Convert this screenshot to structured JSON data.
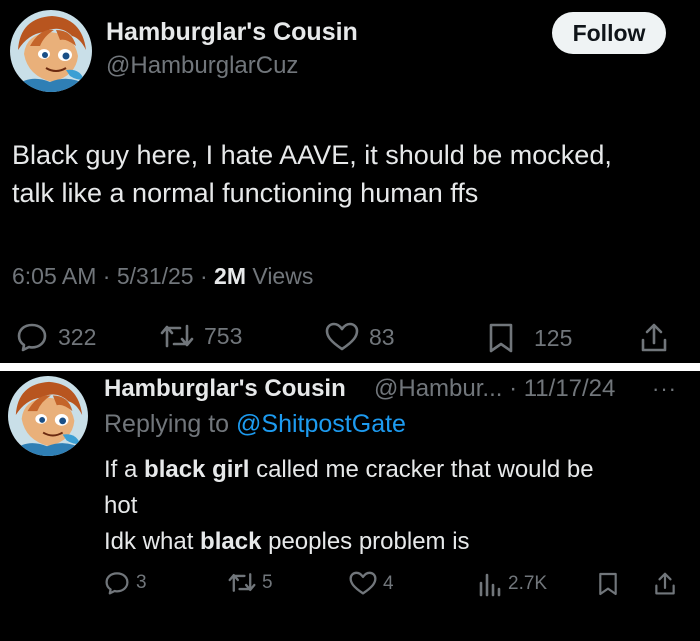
{
  "tweet1": {
    "display_name": "Hamburglar's Cousin",
    "handle": "@HamburglarCuz",
    "follow_label": "Follow",
    "text_line1": "Black guy here, I hate AAVE, it should be mocked,",
    "text_line2": "talk like a normal functioning human ffs",
    "time": "6:05 AM",
    "date": "5/31/25",
    "views_count": "2M",
    "views_label": "Views",
    "replies": "322",
    "reposts": "753",
    "likes": "83",
    "bookmarks": "125"
  },
  "tweet2": {
    "display_name": "Hamburglar's Cousin",
    "handle_date": "@Hambur... · 11/17/24",
    "more": "···",
    "replying_to": "Replying to",
    "mention": "@ShitpostGate",
    "line1_pre": "If a ",
    "line1_bold": "black girl",
    "line1_post": " called me cracker that would be",
    "line2": "hot",
    "line3_pre": "Idk what ",
    "line3_bold": "black",
    "line3_post": " peoples problem is",
    "replies": "3",
    "reposts": "5",
    "likes": "4",
    "views": "2.7K"
  },
  "colors": {
    "background": "#000000",
    "text": "#e7e9ea",
    "secondary": "#71767b",
    "link": "#1d9bf0",
    "follow_bg": "#eff3f4"
  },
  "icons": [
    "avatar-cartoon",
    "reply-icon",
    "repost-icon",
    "like-icon",
    "bookmark-icon",
    "share-icon",
    "views-icon"
  ]
}
